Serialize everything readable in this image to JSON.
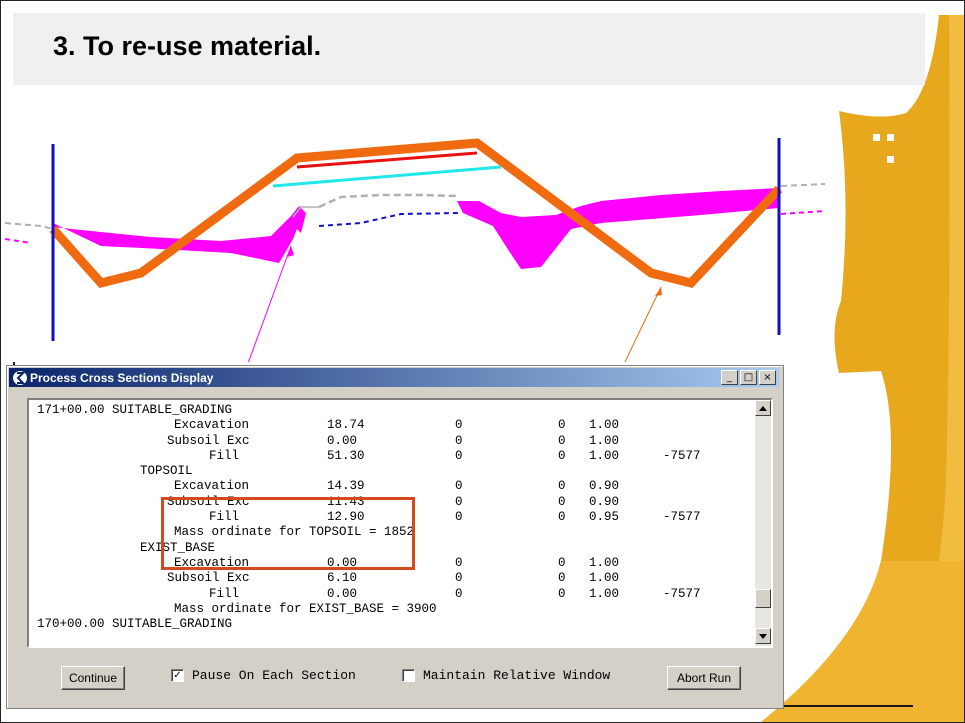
{
  "slide": {
    "title": "3.  To re-use material.",
    "colors": {
      "gold": "#e8a81e",
      "gold_light": "#f4c04a",
      "orange": "#f06a10",
      "magenta": "#ff00ff",
      "blue": "#1010c8",
      "red": "#e81010",
      "cyan": "#20e8e8",
      "grey": "#b0b0b0"
    }
  },
  "dialog": {
    "title": "Process Cross Sections Display",
    "window_controls": {
      "minimize": "_",
      "maximize": "□",
      "close": "×"
    },
    "report": [
      {
        "c": [
          "171+00.00 SUITABLE_GRADING",
          "",
          "",
          "",
          "",
          ""
        ]
      },
      {
        "c": [
          "Excavation",
          "18.74",
          "0",
          "0",
          "1.00",
          ""
        ]
      },
      {
        "c": [
          "Subsoil Exc",
          "0.00",
          "0",
          "0",
          "1.00",
          ""
        ]
      },
      {
        "c": [
          "Fill",
          "51.30",
          "0",
          "0",
          "1.00",
          "-7577"
        ]
      },
      {
        "c": [
          "TOPSOIL",
          "",
          "",
          "",
          "",
          ""
        ]
      },
      {
        "c": [
          "Excavation",
          "14.39",
          "0",
          "0",
          "0.90",
          ""
        ]
      },
      {
        "c": [
          "Subsoil Exc",
          "11.43",
          "0",
          "0",
          "0.90",
          ""
        ]
      },
      {
        "c": [
          "Fill",
          "12.90",
          "0",
          "0",
          "0.95",
          "-7577"
        ]
      },
      {
        "c": [
          "Mass ordinate for TOPSOIL = 1852",
          "",
          "",
          "",
          "",
          ""
        ]
      },
      {
        "c": [
          "EXIST_BASE",
          "",
          "",
          "",
          "",
          ""
        ]
      },
      {
        "c": [
          "Excavation",
          "0.00",
          "0",
          "0",
          "1.00",
          ""
        ]
      },
      {
        "c": [
          "Subsoil Exc",
          "6.10",
          "0",
          "0",
          "1.00",
          ""
        ]
      },
      {
        "c": [
          "Fill",
          "0.00",
          "0",
          "0",
          "1.00",
          "-7577"
        ]
      },
      {
        "c": [
          "Mass ordinate for EXIST_BASE = 3900",
          "",
          "",
          "",
          "",
          ""
        ]
      },
      {
        "c": [
          "170+00.00 SUITABLE_GRADING",
          "",
          "",
          "",
          "",
          ""
        ]
      }
    ],
    "buttons": {
      "continue": "Continue",
      "abort": "Abort Run"
    },
    "checkboxes": {
      "pause": {
        "label": "Pause On Each Section",
        "checked": true
      },
      "maintain": {
        "label": "Maintain Relative Window",
        "checked": false
      }
    }
  }
}
